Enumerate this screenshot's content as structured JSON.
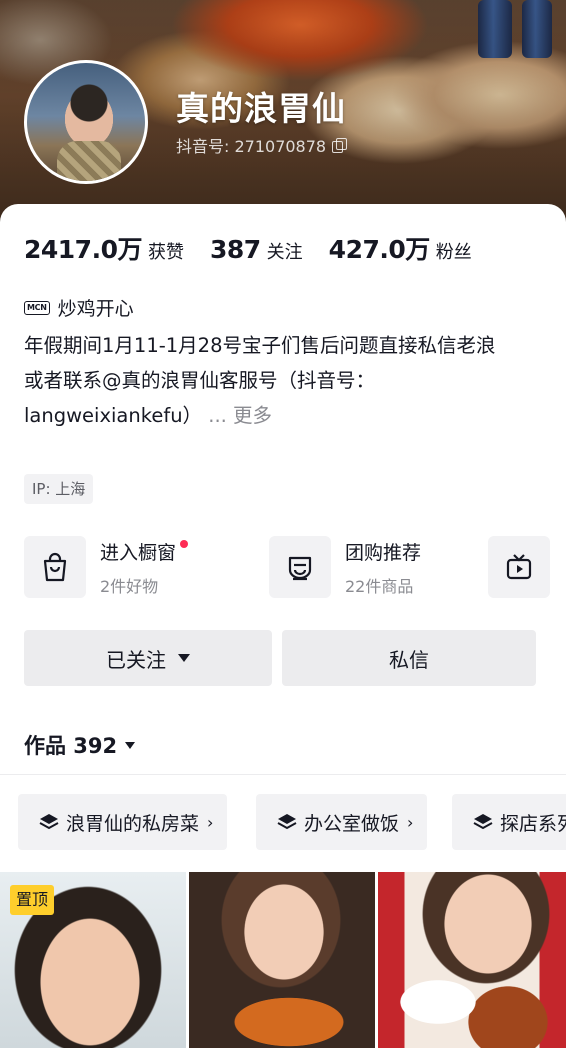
{
  "profile": {
    "username": "真的浪胃仙",
    "douyin_id_label": "抖音号: 271070878"
  },
  "stats": [
    {
      "value": "2417.0万",
      "label": "获赞"
    },
    {
      "value": "387",
      "label": "关注"
    },
    {
      "value": "427.0万",
      "label": "粉丝"
    }
  ],
  "mcn": {
    "badge": "MCN",
    "name": "炒鸡开心"
  },
  "bio": {
    "line1": "年假期间1月11-1月28号宝子们售后问题直接私信老浪",
    "line2": "或者联系@真的浪胃仙客服号（抖音号：langweixiankefu）",
    "more": "... 更多"
  },
  "ip_label": "IP: 上海",
  "shop_cards": [
    {
      "title": "进入橱窗",
      "subtitle": "2件好物",
      "icon": "shopping-bag-icon",
      "has_dot": true
    },
    {
      "title": "团购推荐",
      "subtitle": "22件商品",
      "icon": "group-buy-icon",
      "has_dot": false
    },
    {
      "title": "",
      "subtitle": "",
      "icon": "live-tv-icon",
      "has_dot": false
    }
  ],
  "actions": {
    "followed_label": "已关注",
    "message_label": "私信"
  },
  "works": {
    "label": "作品 392"
  },
  "collections": [
    {
      "label": "浪胃仙的私房菜"
    },
    {
      "label": "办公室做饭"
    },
    {
      "label": "探店系列"
    }
  ],
  "videos": [
    {
      "pinned_label": "置顶"
    },
    {
      "pinned_label": ""
    },
    {
      "pinned_label": ""
    }
  ],
  "colors": {
    "accent_red": "#fe2c55",
    "pin_yellow": "#fece2c",
    "text_primary": "#161823",
    "text_secondary": "#8a8b91"
  }
}
